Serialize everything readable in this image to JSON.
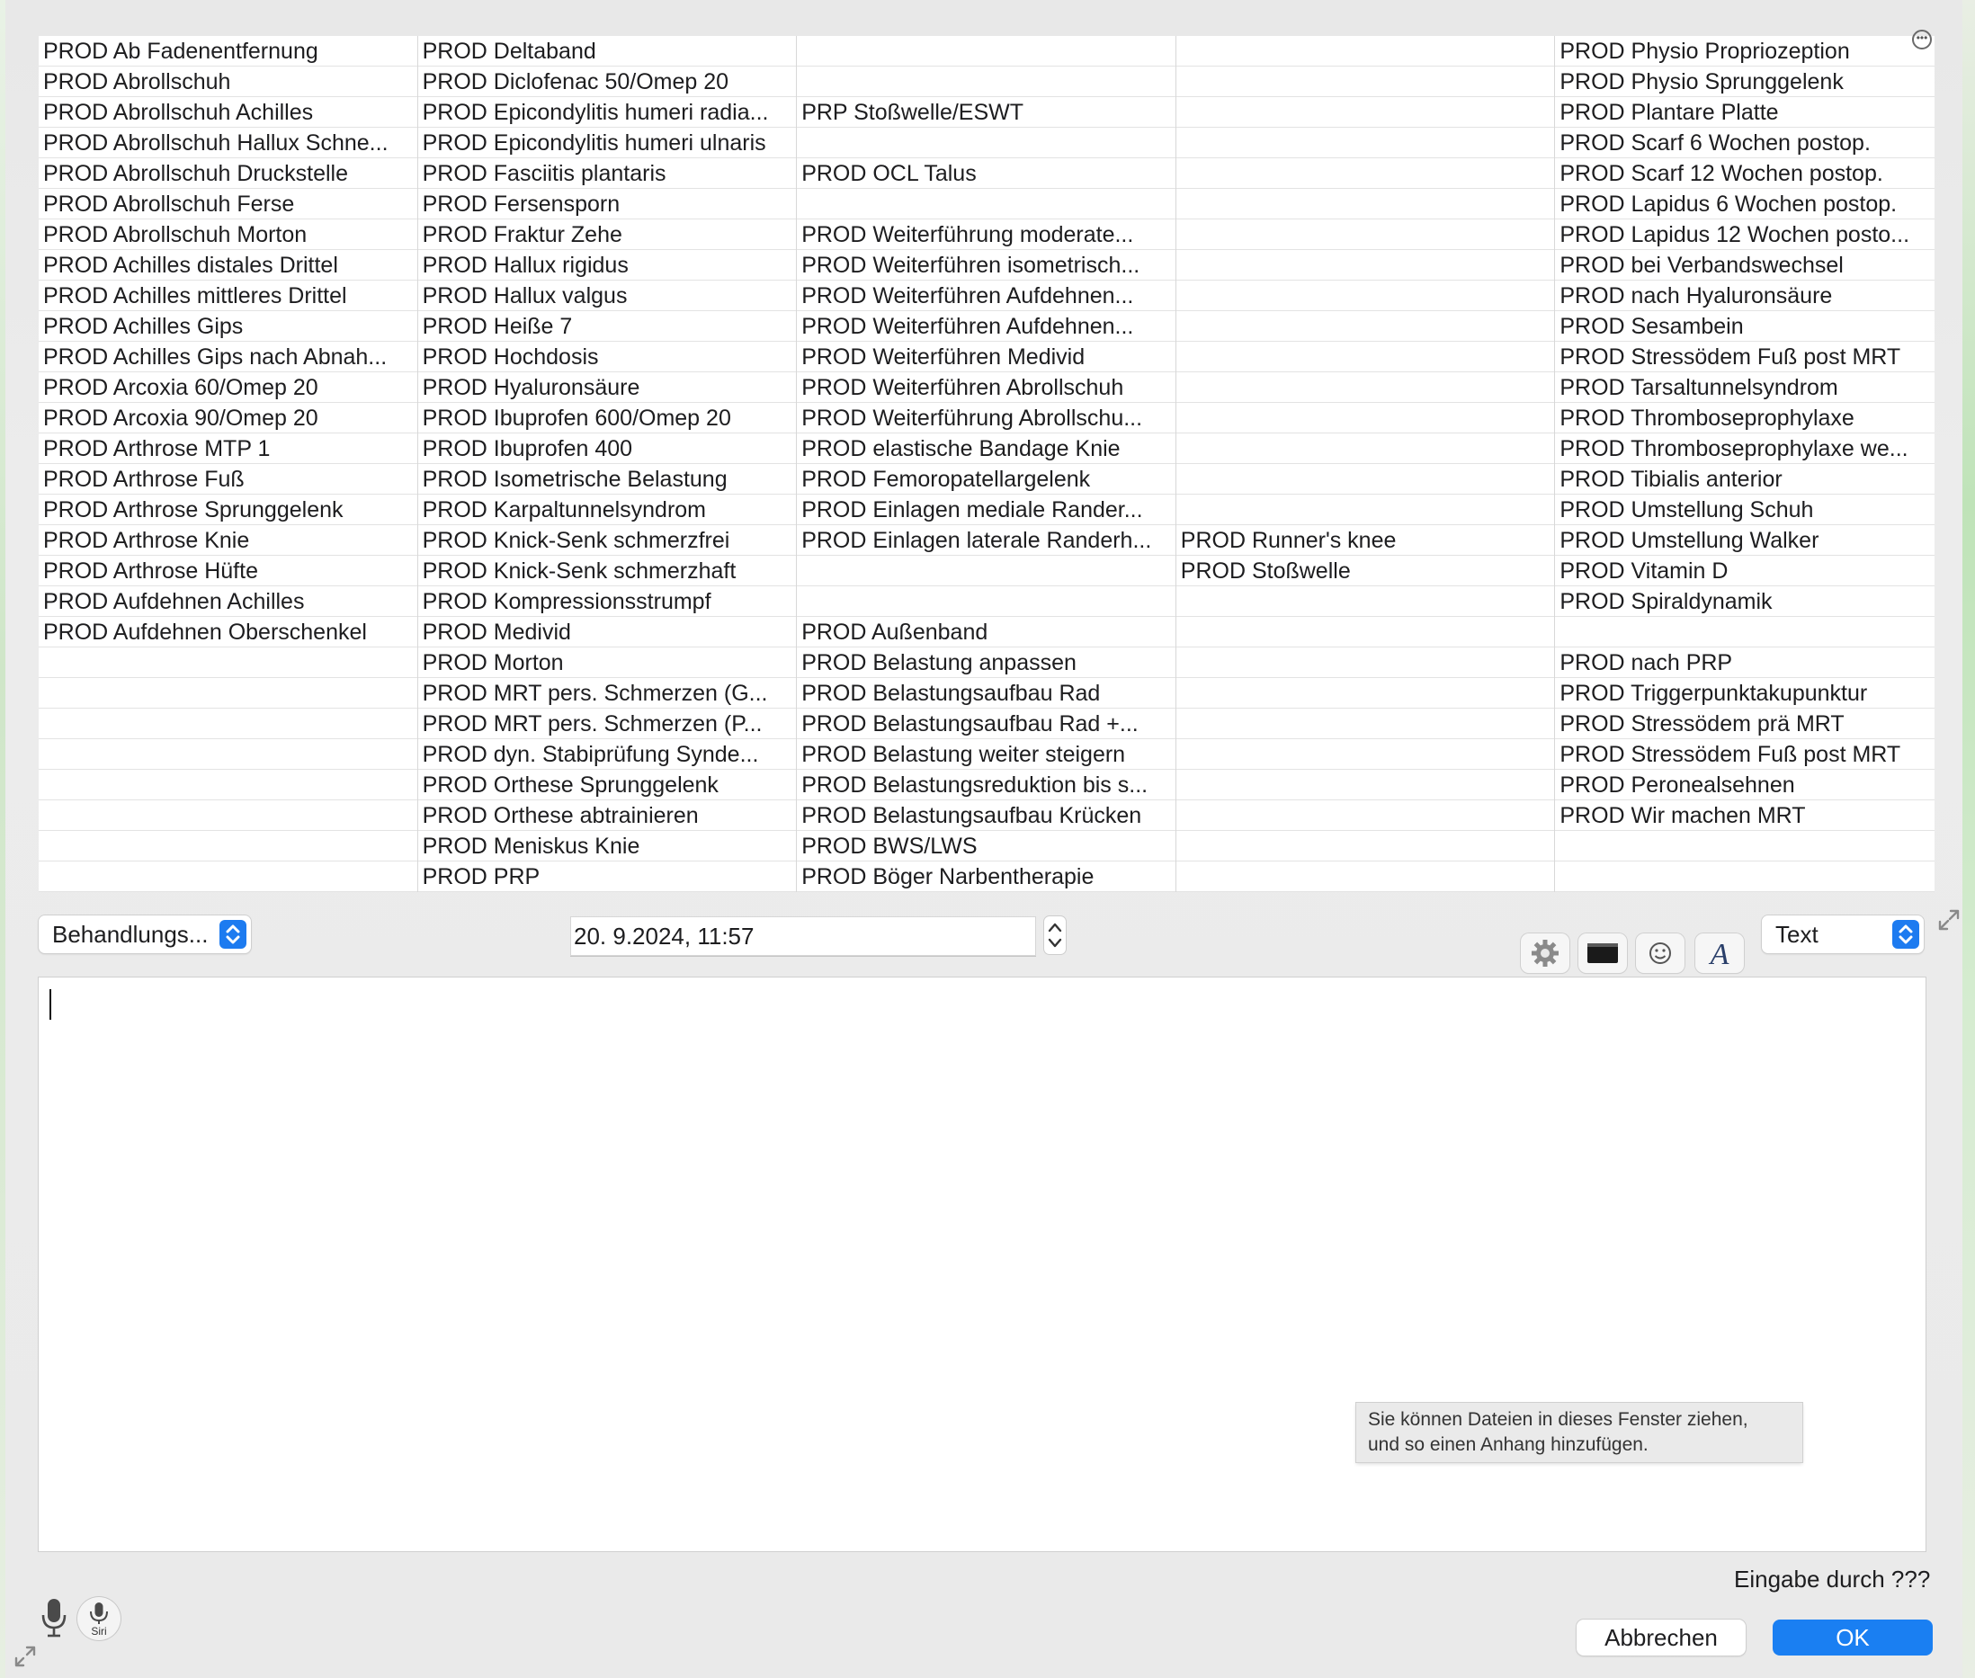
{
  "grid": {
    "columns": [
      [
        "PROD Ab Fadenentfernung",
        "PROD Abrollschuh",
        "PROD Abrollschuh Achilles",
        "PROD Abrollschuh Hallux Schne...",
        "PROD Abrollschuh Druckstelle",
        "PROD Abrollschuh Ferse",
        "PROD Abrollschuh Morton",
        "PROD Achilles distales Drittel",
        "PROD Achilles mittleres Drittel",
        "PROD Achilles Gips",
        "PROD Achilles Gips nach Abnah...",
        "PROD Arcoxia 60/Omep 20",
        "PROD Arcoxia 90/Omep 20",
        "PROD Arthrose MTP 1",
        "PROD Arthrose Fuß",
        "PROD Arthrose Sprunggelenk",
        "PROD Arthrose Knie",
        "PROD Arthrose Hüfte",
        "PROD Aufdehnen Achilles",
        "PROD Aufdehnen Oberschenkel",
        "",
        "",
        "",
        "",
        "",
        "",
        "",
        ""
      ],
      [
        "PROD Deltaband",
        "PROD Diclofenac 50/Omep 20",
        "PROD Epicondylitis humeri radia...",
        "PROD Epicondylitis humeri ulnaris",
        "PROD Fasciitis plantaris",
        "PROD Fersensporn",
        "PROD Fraktur Zehe",
        "PROD Hallux rigidus",
        "PROD Hallux valgus",
        "PROD Heiße 7",
        "PROD Hochdosis",
        "PROD Hyaluronsäure",
        "PROD Ibuprofen 600/Omep 20",
        "PROD Ibuprofen 400",
        "PROD Isometrische Belastung",
        "PROD Karpaltunnelsyndrom",
        "PROD Knick-Senk schmerzfrei",
        "PROD Knick-Senk schmerzhaft",
        "PROD Kompressionsstrumpf",
        "PROD Medivid",
        "PROD Morton",
        "PROD MRT pers. Schmerzen (G...",
        "PROD MRT pers. Schmerzen (P...",
        "PROD dyn. Stabiprüfung Synde...",
        "PROD Orthese Sprunggelenk",
        "PROD Orthese abtrainieren",
        "PROD Meniskus Knie",
        "PROD PRP"
      ],
      [
        "",
        "",
        "PRP Stoßwelle/ESWT",
        "",
        "PROD OCL Talus",
        "",
        "PROD Weiterführung moderate...",
        "PROD Weiterführen isometrisch...",
        "PROD Weiterführen Aufdehnen...",
        "PROD Weiterführen Aufdehnen...",
        "PROD Weiterführen Medivid",
        "PROD Weiterführen Abrollschuh",
        "PROD Weiterführung Abrollschu...",
        "PROD elastische Bandage Knie",
        "PROD Femoropatellargelenk",
        "PROD Einlagen mediale Rander...",
        "PROD Einlagen laterale Randerh...",
        "",
        "",
        "PROD Außenband",
        "PROD Belastung anpassen",
        "PROD Belastungsaufbau Rad",
        "PROD Belastungsaufbau Rad +...",
        "PROD Belastung weiter steigern",
        "PROD Belastungsreduktion bis s...",
        "PROD Belastungsaufbau Krücken",
        "PROD BWS/LWS",
        "PROD Böger Narbentherapie"
      ],
      [
        "",
        "",
        "",
        "",
        "",
        "",
        "",
        "",
        "",
        "",
        "",
        "",
        "",
        "",
        "",
        "",
        "PROD Runner's knee",
        "PROD Stoßwelle",
        "",
        "",
        "",
        "",
        "",
        "",
        "",
        "",
        "",
        ""
      ],
      [
        "PROD Physio Propriozeption",
        "PROD Physio Sprunggelenk",
        "PROD Plantare Platte",
        "PROD Scarf 6 Wochen postop.",
        "PROD Scarf 12 Wochen postop.",
        "PROD Lapidus 6 Wochen postop.",
        "PROD Lapidus 12 Wochen posto...",
        "PROD bei Verbandswechsel",
        "PROD nach Hyaluronsäure",
        "PROD Sesambein",
        "PROD Stressödem Fuß post MRT",
        "PROD Tarsaltunnelsyndrom",
        "PROD Thromboseprophylaxe",
        "PROD Thromboseprophylaxe we...",
        "PROD Tibialis anterior",
        "PROD Umstellung Schuh",
        "PROD Umstellung Walker",
        "PROD Vitamin D",
        "PROD Spiraldynamik",
        "",
        "PROD nach PRP",
        "PROD Triggerpunktakupunktur",
        "PROD Stressödem prä MRT",
        "PROD Stressödem Fuß post MRT",
        "PROD Peronealsehnen",
        "PROD Wir machen MRT",
        "",
        ""
      ]
    ]
  },
  "controls": {
    "category_popup": "Behandlungs...",
    "datetime": "20.  9.2024, 11:57",
    "format_popup": "Text"
  },
  "toolbar_icons": [
    "gear-icon",
    "terminal-icon",
    "emoji-icon",
    "font-icon"
  ],
  "tooltip": {
    "line1": "Sie können Dateien in dieses Fenster ziehen,",
    "line2": "und so einen Anhang hinzufügen."
  },
  "footer": {
    "eingabe": "Eingabe durch ???",
    "cancel": "Abbrechen",
    "ok": "OK",
    "siri_label": "Siri"
  },
  "colors": {
    "accent": "#1a7ff2",
    "grid_background": "#ffffff"
  }
}
